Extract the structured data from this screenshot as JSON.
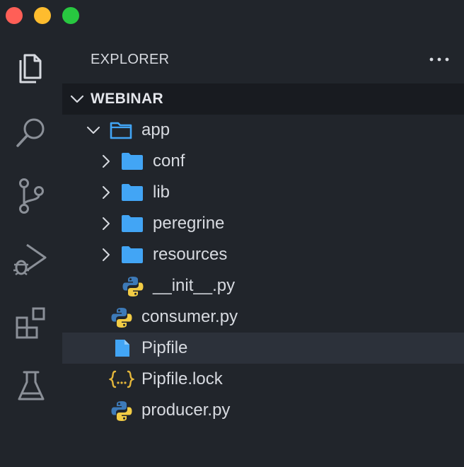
{
  "window": {
    "traffic_lights": [
      "close",
      "minimize",
      "maximize"
    ]
  },
  "activity_bar": {
    "items": [
      {
        "icon": "files-icon",
        "active": true
      },
      {
        "icon": "search-icon",
        "active": false
      },
      {
        "icon": "source-control-icon",
        "active": false
      },
      {
        "icon": "run-debug-icon",
        "active": false
      },
      {
        "icon": "extensions-icon",
        "active": false
      },
      {
        "icon": "testing-flask-icon",
        "active": false
      }
    ]
  },
  "sidebar": {
    "title": "EXPLORER",
    "more_icon": "ellipsis-icon",
    "section": {
      "title": "WEBINAR",
      "expanded": true
    },
    "tree": [
      {
        "label": "app",
        "type": "folder",
        "expanded": true
      },
      {
        "label": "conf",
        "type": "folder",
        "expanded": false
      },
      {
        "label": "lib",
        "type": "folder",
        "expanded": false
      },
      {
        "label": "peregrine",
        "type": "folder",
        "expanded": false
      },
      {
        "label": "resources",
        "type": "folder",
        "expanded": false
      },
      {
        "label": "__init__.py",
        "type": "python"
      },
      {
        "label": "consumer.py",
        "type": "python"
      },
      {
        "label": "Pipfile",
        "type": "file",
        "selected": true
      },
      {
        "label": "Pipfile.lock",
        "type": "json"
      },
      {
        "label": "producer.py",
        "type": "python"
      }
    ]
  },
  "colors": {
    "background": "#21252b",
    "section_header_bg": "#181b20",
    "selected_row_bg": "#2c313a",
    "text": "#d7dae0",
    "folder_blue": "#42a5f5",
    "python_blue": "#3d7ab8",
    "python_yellow": "#f2cc45",
    "json_brace": "#e5b73b",
    "icon_gray": "#8b9098"
  }
}
